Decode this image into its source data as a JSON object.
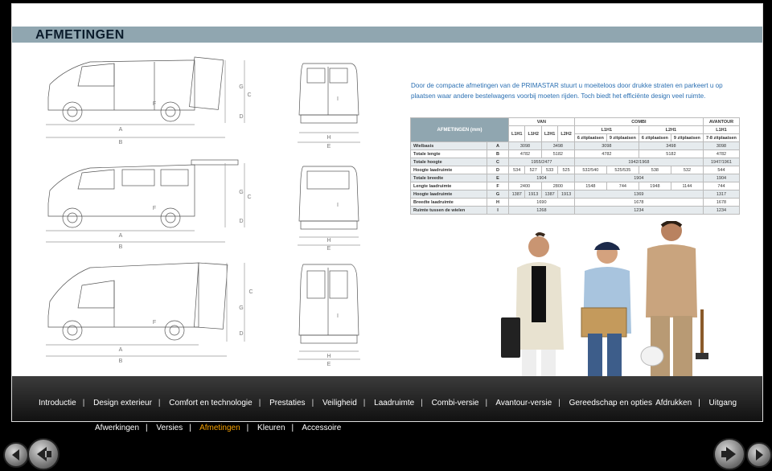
{
  "title": "AFMETINGEN",
  "intro": "Door de compacte afmetingen van de PRIMASTAR stuurt u moeiteloos door drukke straten en parkeert u op plaatsen waar andere bestelwagens voorbij moeten rijden. Toch biedt het efficiënte design veel ruimte.",
  "dimension_labels": {
    "A": "A",
    "B": "B",
    "C": "C",
    "D": "D",
    "E": "E",
    "F": "F",
    "G": "G",
    "H": "H",
    "I": "I"
  },
  "table": {
    "corner": "AFMETINGEN (mm)",
    "groups": [
      "VAN",
      "COMBI",
      "AVANTOUR"
    ],
    "models": [
      "L1H1",
      "L1H2",
      "L2H1",
      "L2H2",
      "L1H1",
      "L2H1",
      "L1H1"
    ],
    "seats": [
      "6 zitplaatsen",
      "9 zitplaatsen",
      "6 zitplaatsen",
      "9 zitplaatsen",
      "7-8 zitplaatsen"
    ],
    "rows": [
      {
        "label": "Wielbasis",
        "letter": "A",
        "cells": [
          "3098",
          "",
          "3498",
          "",
          "3098",
          "",
          "3498",
          "",
          "3098"
        ]
      },
      {
        "label": "Totale lengte",
        "letter": "B",
        "cells": [
          "4782",
          "",
          "5182",
          "",
          "4782",
          "",
          "5182",
          "",
          "4782"
        ]
      },
      {
        "label": "Totale hoogte",
        "letter": "C",
        "cells": [
          "1955/2477",
          "",
          "",
          "",
          "1942/1968",
          "",
          "",
          "",
          "1947/1961"
        ]
      },
      {
        "label": "Hoogte laadruimte",
        "letter": "D",
        "cells": [
          "534",
          "527",
          "533",
          "525",
          "532/540",
          "525/535",
          "538",
          "532",
          "544"
        ]
      },
      {
        "label": "Totale breedte",
        "letter": "E",
        "cells": [
          "1904",
          "",
          "",
          "",
          "1904",
          "",
          "",
          "",
          "1904"
        ]
      },
      {
        "label": "Lengte laadruimte",
        "letter": "F",
        "cells": [
          "2400",
          "",
          "2800",
          "",
          "1548",
          "744",
          "1948",
          "1144",
          "744"
        ]
      },
      {
        "label": "Hoogte laadruimte",
        "letter": "G",
        "cells": [
          "1387",
          "1913",
          "1387",
          "1913",
          "1369",
          "",
          "",
          "",
          "1317"
        ]
      },
      {
        "label": "Breedte laadruimte",
        "letter": "H",
        "cells": [
          "1690",
          "",
          "",
          "",
          "1678",
          "",
          "",
          "",
          "1678"
        ]
      },
      {
        "label": "Ruimte tussen de wielen",
        "letter": "I",
        "cells": [
          "1268",
          "",
          "",
          "",
          "1234",
          "",
          "",
          "",
          "1234"
        ]
      }
    ]
  },
  "nav": {
    "items": [
      "Introductie",
      "Design exterieur",
      "Comfort en technologie",
      "Prestaties",
      "Veiligheid",
      "Laadruimte",
      "Combi-versie",
      "Avantour-versie",
      "Gereedschap en opties"
    ],
    "right": [
      "Afdrukken",
      "Uitgang"
    ],
    "separator": "|"
  },
  "subnav": {
    "items": [
      "Afwerkingen",
      "Versies",
      "Afmetingen",
      "Kleuren",
      "Accessoire"
    ],
    "active": "Afmetingen"
  },
  "colors": {
    "title_bar": "#90a6b0",
    "intro_text": "#2a6fb2",
    "active_sub": "#f5a000"
  },
  "icons": [
    "prev-first-icon",
    "prev-icon",
    "next-icon",
    "next-last-icon"
  ]
}
